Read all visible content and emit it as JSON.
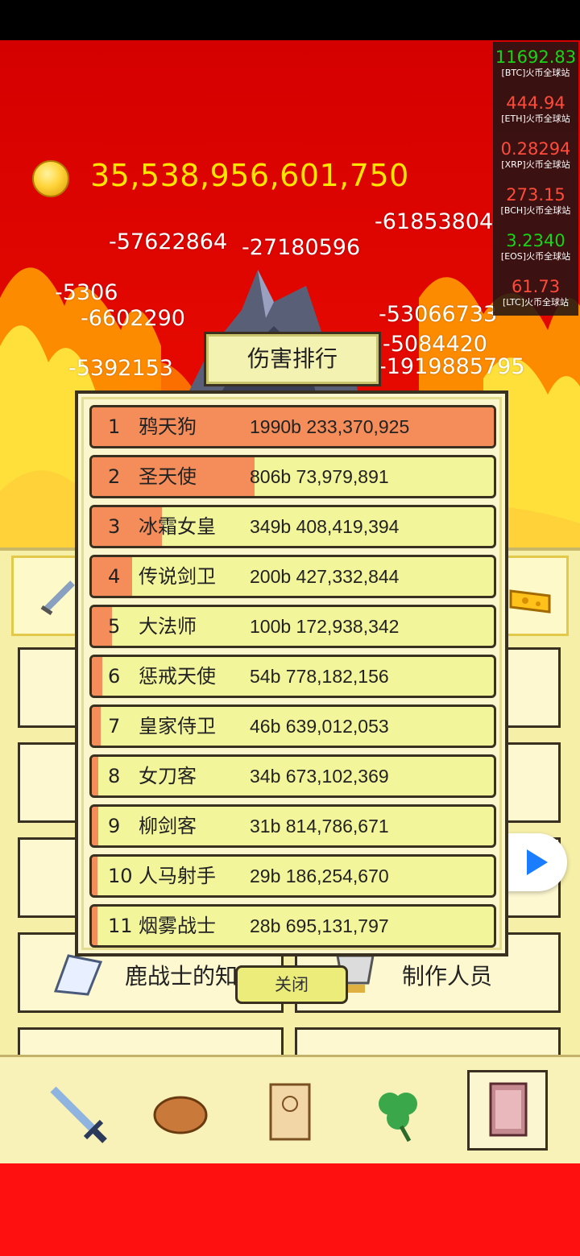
{
  "coins": "35,538,956,601,750",
  "ticker": [
    {
      "value": "11692.83",
      "name": "[BTC]火币全球站",
      "color": "#19d419"
    },
    {
      "value": "444.94",
      "name": "[ETH]火币全球站",
      "color": "#ff4b3a"
    },
    {
      "value": "0.28294",
      "name": "[XRP]火币全球站",
      "color": "#ff4b3a"
    },
    {
      "value": "273.15",
      "name": "[BCH]火币全球站",
      "color": "#ff4b3a"
    },
    {
      "value": "3.2340",
      "name": "[EOS]火币全球站",
      "color": "#19d419"
    },
    {
      "value": "61.73",
      "name": "[LTC]火币全球站",
      "color": "#ff4b3a"
    }
  ],
  "damage_numbers": [
    "-61853804",
    "-57622864",
    "-27180596",
    "-5306",
    "-6602290",
    "-1919885795",
    "-5084420",
    "-53066733",
    "-5392153"
  ],
  "dialog": {
    "title": "伤害排行",
    "close_label": "关闭"
  },
  "ranking": [
    {
      "rank": "1",
      "name": "鸦天狗",
      "value": "1990b 233,370,925",
      "fraction": 1.0
    },
    {
      "rank": "2",
      "name": "圣天使",
      "value": "806b 73,979,891",
      "fraction": 0.405
    },
    {
      "rank": "3",
      "name": "冰霜女皇",
      "value": "349b 408,419,394",
      "fraction": 0.175
    },
    {
      "rank": "4",
      "name": "传说剑卫",
      "value": "200b 427,332,844",
      "fraction": 0.1
    },
    {
      "rank": "5",
      "name": "大法师",
      "value": "100b 172,938,342",
      "fraction": 0.05
    },
    {
      "rank": "6",
      "name": "惩戒天使",
      "value": "54b 778,182,156",
      "fraction": 0.027
    },
    {
      "rank": "7",
      "name": "皇家侍卫",
      "value": "46b 639,012,053",
      "fraction": 0.023
    },
    {
      "rank": "8",
      "name": "女刀客",
      "value": "34b 673,102,369",
      "fraction": 0.017
    },
    {
      "rank": "9",
      "name": "柳剑客",
      "value": "31b 814,786,671",
      "fraction": 0.016
    },
    {
      "rank": "10",
      "name": "人马射手",
      "value": "29b 186,254,670",
      "fraction": 0.015
    },
    {
      "rank": "11",
      "name": "烟雾战士",
      "value": "28b 695,131,797",
      "fraction": 0.014
    }
  ],
  "cards": {
    "left_label": "鹿战士的知识",
    "right_label": "制作人员"
  },
  "nav": [
    "sword-icon",
    "bread-icon",
    "scroll-icon",
    "clover-icon",
    "book-icon"
  ]
}
